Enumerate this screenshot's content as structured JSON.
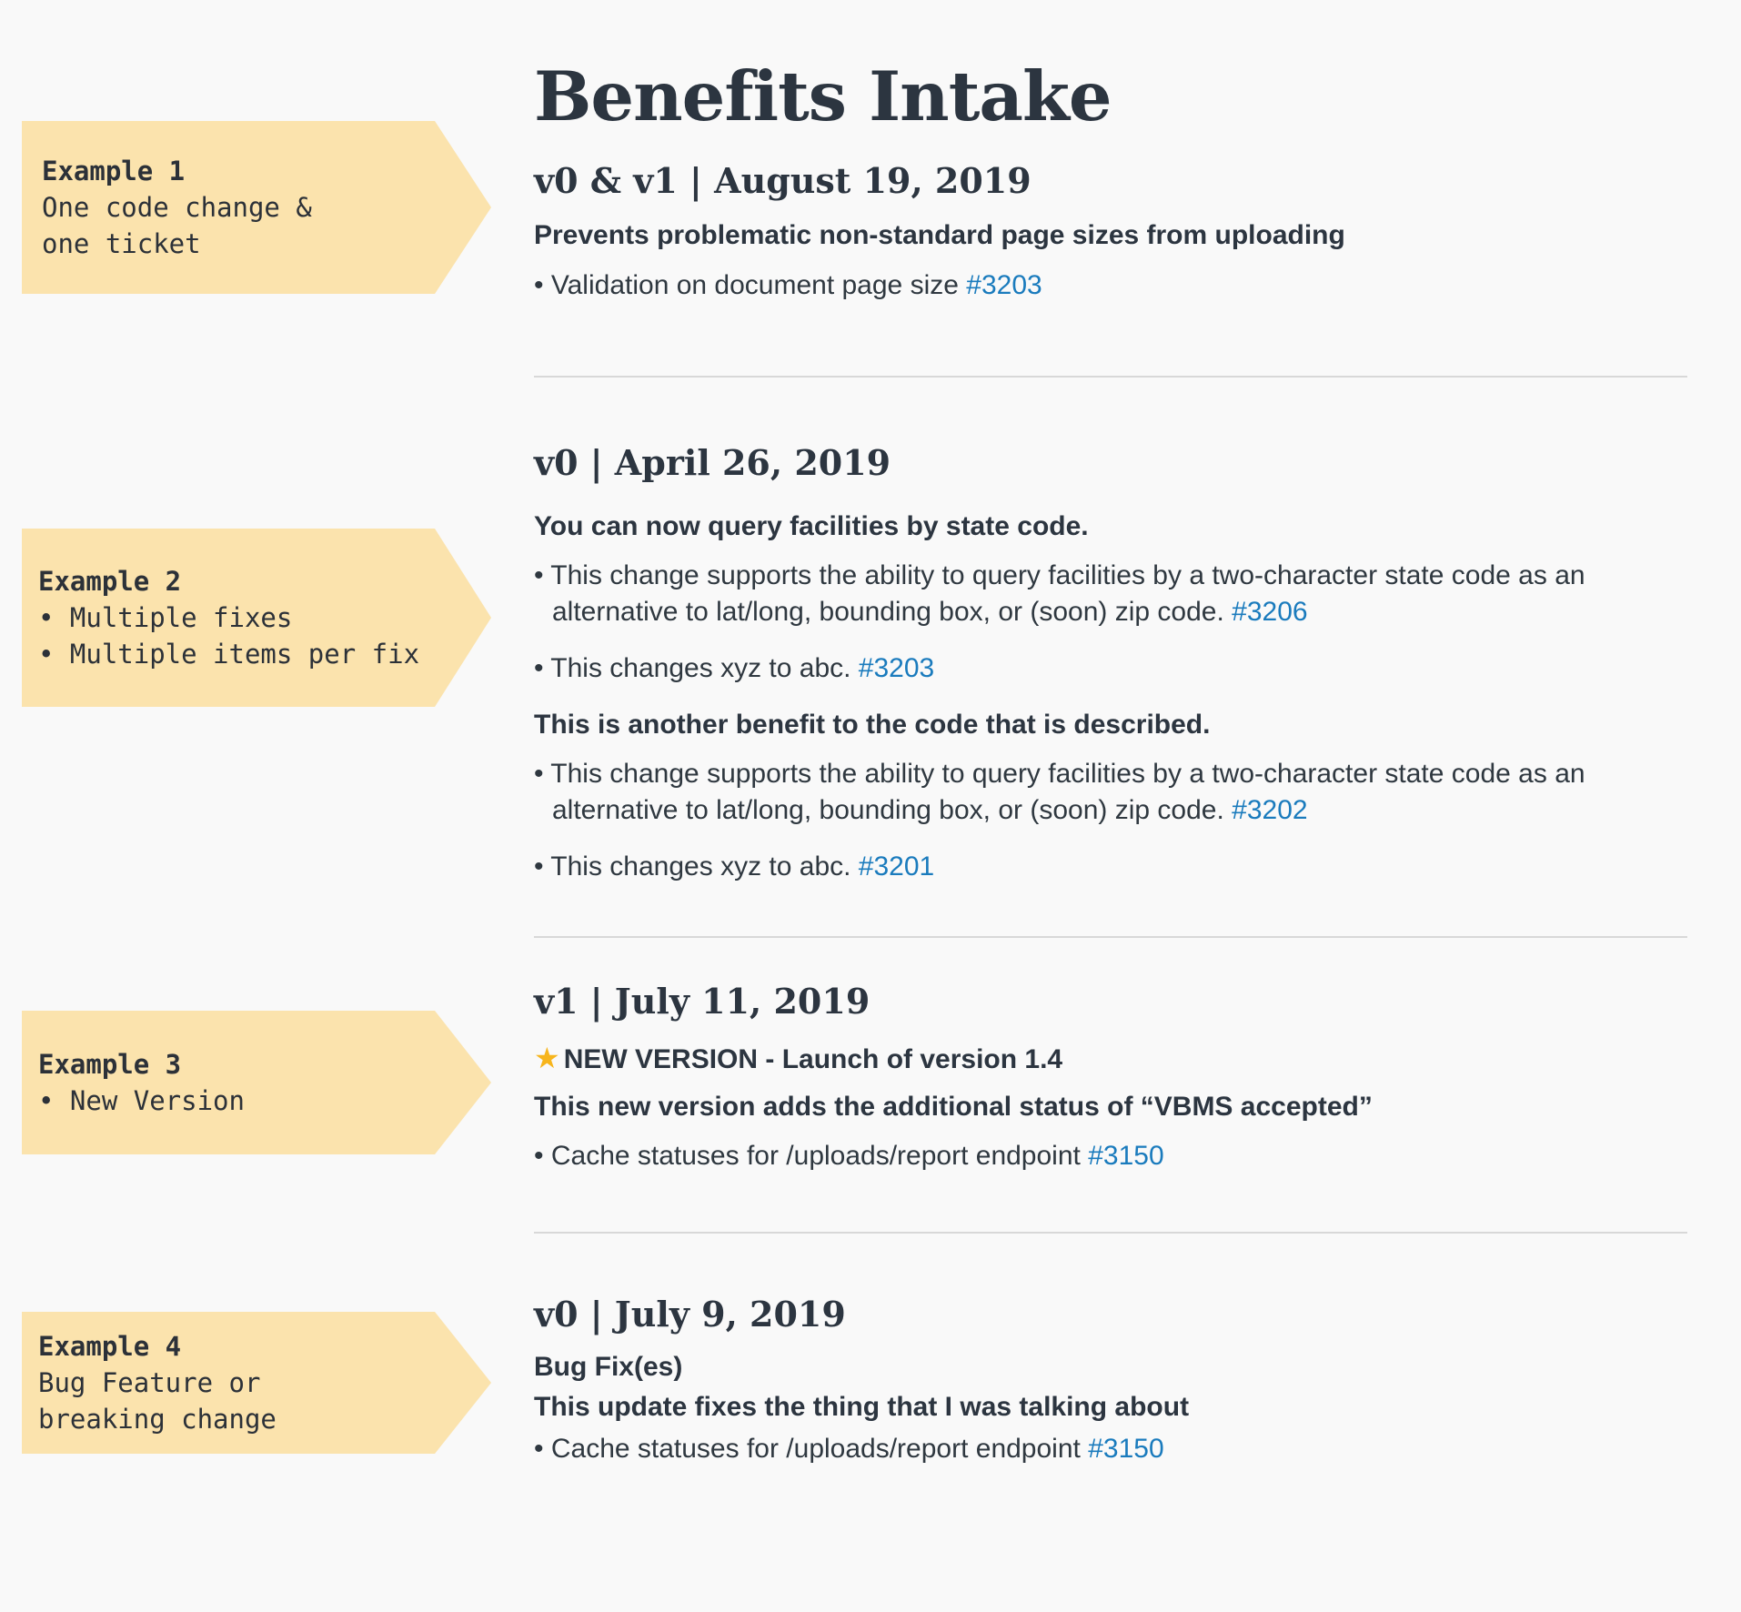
{
  "page_title": "Benefits Intake",
  "examples": [
    {
      "title": "Example 1",
      "lines": [
        "One code change &",
        "one ticket"
      ]
    },
    {
      "title": "Example 2",
      "lines": [
        "• Multiple fixes",
        "• Multiple items per fix"
      ]
    },
    {
      "title": "Example 3",
      "lines": [
        "• New Version"
      ]
    },
    {
      "title": "Example 4",
      "lines": [
        "Bug Feature or",
        "breaking change"
      ]
    }
  ],
  "entries": [
    {
      "heading": "v0 & v1 | August 19, 2019",
      "summary": "Prevents problematic non-standard page sizes from uploading",
      "items": [
        {
          "text": "• Validation on document page size ",
          "link": "#3203"
        }
      ]
    },
    {
      "heading": "v0 | April 26, 2019",
      "groups": [
        {
          "summary": "You can now query facilities by state code.",
          "items": [
            {
              "line1": "• This change supports the ability to query facilities by a two-character state code as an",
              "line2": "alternative to lat/long, bounding box, or (soon) zip code. ",
              "link": "#3206"
            },
            {
              "text": "• This changes xyz to abc. ",
              "link": "#3203"
            }
          ]
        },
        {
          "summary": "This is another benefit to the code that is described.",
          "items": [
            {
              "line1": "• This change supports the ability to query facilities by a two-character state code as an",
              "line2": "alternative to lat/long, bounding box, or (soon) zip code. ",
              "link": "#3202"
            },
            {
              "text": "• This changes xyz to abc. ",
              "link": "#3201"
            }
          ]
        }
      ]
    },
    {
      "heading": "v1 | July 11, 2019",
      "badge": "NEW VERSION - Launch of version 1.4",
      "summary": "This new version adds the additional status of “VBMS accepted”",
      "items": [
        {
          "text": "• Cache statuses for /uploads/report endpoint ",
          "link": "#3150"
        }
      ]
    },
    {
      "heading": "v0 | July 9, 2019",
      "label": "Bug Fix(es)",
      "summary": "This update fixes the thing that I was talking about",
      "items": [
        {
          "text": "• Cache statuses for /uploads/report endpoint ",
          "link": "#3150"
        }
      ]
    }
  ]
}
